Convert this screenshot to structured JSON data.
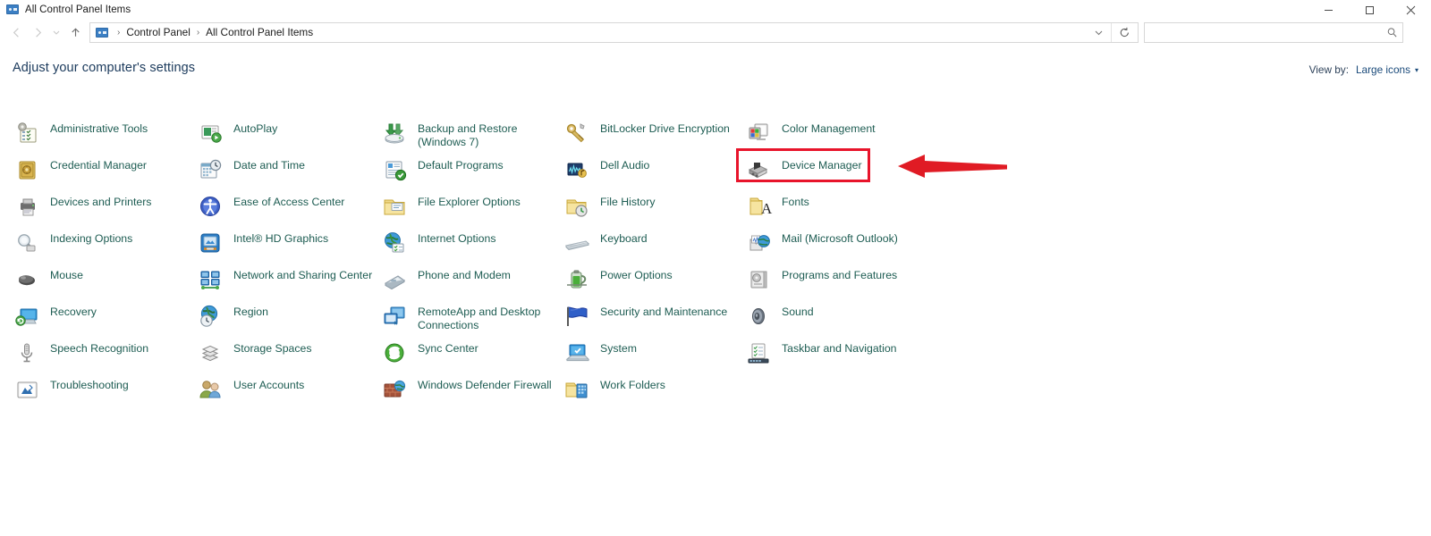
{
  "window": {
    "title": "All Control Panel Items",
    "icon": "control-panel-icon",
    "buttons": {
      "minimize": "—",
      "maximize": "❐",
      "close": "×"
    }
  },
  "nav": {
    "back": "back-arrow",
    "forward": "forward-arrow",
    "recent": "recent-locations",
    "up": "up-arrow",
    "breadcrumb": {
      "icon": "control-panel-icon",
      "separator": "›",
      "items": [
        "Control Panel",
        "All Control Panel Items"
      ]
    },
    "dropdown": "chevron-down-icon",
    "refresh": "refresh-icon"
  },
  "search": {
    "value": "",
    "placeholder": "",
    "icon": "search-icon"
  },
  "header": {
    "title": "Adjust your computer's settings",
    "view_by_label": "View by:",
    "view_by_value": "Large icons",
    "view_by_caret": "▾"
  },
  "annotation": {
    "highlight_color": "#e8142b",
    "highlighted_item": "Device Manager",
    "arrow_color": "#e01b24",
    "arrow_direction": "left"
  },
  "columns": [
    {
      "items": [
        {
          "label": "Administrative Tools",
          "icon": "administrative-tools-icon"
        },
        {
          "label": "Credential Manager",
          "icon": "credential-manager-icon"
        },
        {
          "label": "Devices and Printers",
          "icon": "devices-and-printers-icon"
        },
        {
          "label": "Indexing Options",
          "icon": "indexing-options-icon"
        },
        {
          "label": "Mouse",
          "icon": "mouse-icon"
        },
        {
          "label": "Recovery",
          "icon": "recovery-icon"
        },
        {
          "label": "Speech Recognition",
          "icon": "speech-recognition-icon"
        },
        {
          "label": "Troubleshooting",
          "icon": "troubleshooting-icon"
        }
      ]
    },
    {
      "items": [
        {
          "label": "AutoPlay",
          "icon": "autoplay-icon"
        },
        {
          "label": "Date and Time",
          "icon": "date-and-time-icon"
        },
        {
          "label": "Ease of Access Center",
          "icon": "ease-of-access-icon"
        },
        {
          "label": "Intel® HD Graphics",
          "icon": "intel-hd-graphics-icon"
        },
        {
          "label": "Network and Sharing Center",
          "icon": "network-sharing-icon"
        },
        {
          "label": "Region",
          "icon": "region-icon"
        },
        {
          "label": "Storage Spaces",
          "icon": "storage-spaces-icon"
        },
        {
          "label": "User Accounts",
          "icon": "user-accounts-icon"
        }
      ]
    },
    {
      "items": [
        {
          "label": "Backup and Restore (Windows 7)",
          "icon": "backup-restore-icon"
        },
        {
          "label": "Default Programs",
          "icon": "default-programs-icon"
        },
        {
          "label": "File Explorer Options",
          "icon": "file-explorer-options-icon"
        },
        {
          "label": "Internet Options",
          "icon": "internet-options-icon"
        },
        {
          "label": "Phone and Modem",
          "icon": "phone-and-modem-icon"
        },
        {
          "label": "RemoteApp and Desktop Connections",
          "icon": "remoteapp-desktop-icon"
        },
        {
          "label": "Sync Center",
          "icon": "sync-center-icon"
        },
        {
          "label": "Windows Defender Firewall",
          "icon": "windows-defender-firewall-icon"
        }
      ]
    },
    {
      "items": [
        {
          "label": "BitLocker Drive Encryption",
          "icon": "bitlocker-icon"
        },
        {
          "label": "Dell Audio",
          "icon": "dell-audio-icon"
        },
        {
          "label": "File History",
          "icon": "file-history-icon"
        },
        {
          "label": "Keyboard",
          "icon": "keyboard-icon"
        },
        {
          "label": "Power Options",
          "icon": "power-options-icon"
        },
        {
          "label": "Security and Maintenance",
          "icon": "security-maintenance-icon"
        },
        {
          "label": "System",
          "icon": "system-icon"
        },
        {
          "label": "Work Folders",
          "icon": "work-folders-icon"
        }
      ]
    },
    {
      "items": [
        {
          "label": "Color Management",
          "icon": "color-management-icon"
        },
        {
          "label": "Device Manager",
          "icon": "device-manager-icon"
        },
        {
          "label": "Fonts",
          "icon": "fonts-icon"
        },
        {
          "label": "Mail (Microsoft Outlook)",
          "icon": "mail-outlook-icon"
        },
        {
          "label": "Programs and Features",
          "icon": "programs-features-icon"
        },
        {
          "label": "Sound",
          "icon": "sound-icon"
        },
        {
          "label": "Taskbar and Navigation",
          "icon": "taskbar-navigation-icon"
        }
      ]
    }
  ]
}
